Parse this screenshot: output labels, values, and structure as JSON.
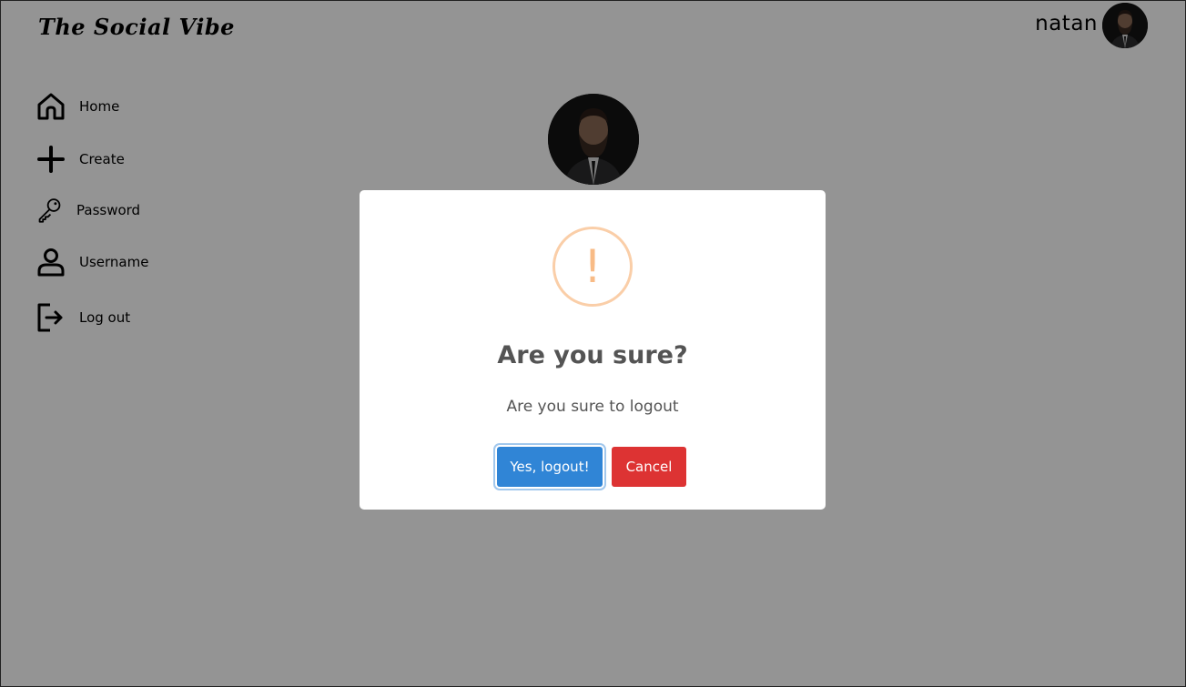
{
  "header": {
    "brand": "The Social Vibe",
    "username": "natan"
  },
  "sidebar": {
    "items": [
      {
        "label": "Home",
        "icon": "home-icon"
      },
      {
        "label": "Create",
        "icon": "plus-icon"
      },
      {
        "label": "Password",
        "icon": "key-icon"
      },
      {
        "label": "Username",
        "icon": "user-icon"
      },
      {
        "label": "Log out",
        "icon": "logout-icon"
      }
    ]
  },
  "dialog": {
    "icon": "warning-icon",
    "icon_glyph": "!",
    "title": "Are you sure?",
    "text": "Are you sure to logout",
    "confirm_label": "Yes, logout!",
    "cancel_label": "Cancel"
  },
  "colors": {
    "confirm": "#3085d6",
    "cancel": "#dd3333",
    "warning": "#f8bb86",
    "overlay": "rgba(0,0,0,0.42)"
  }
}
